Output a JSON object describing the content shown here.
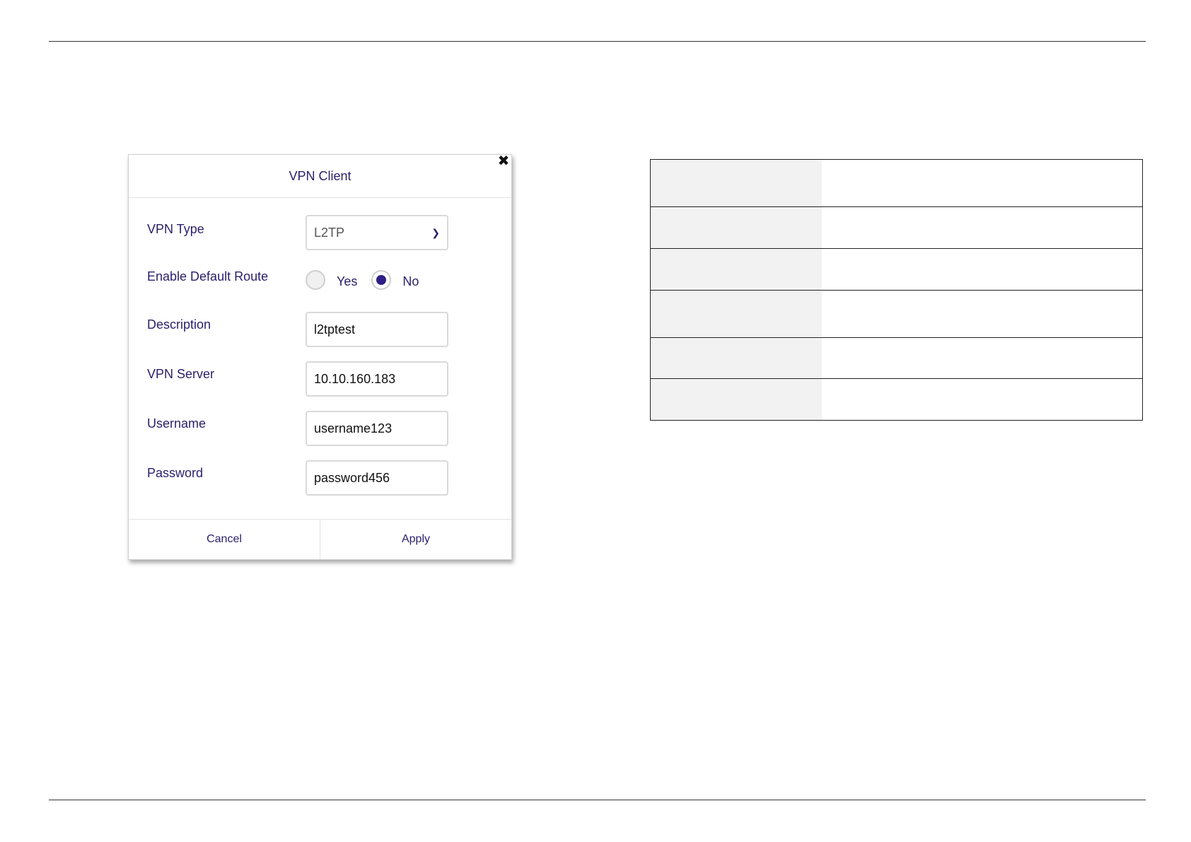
{
  "dialog": {
    "title": "VPN Client",
    "close_icon": "close-icon",
    "fields": {
      "vpn_type": {
        "label": "VPN Type",
        "value": "L2TP"
      },
      "default_route": {
        "label": "Enable Default Route",
        "options": [
          "Yes",
          "No"
        ],
        "selected": "No"
      },
      "description": {
        "label": "Description",
        "value": "l2tptest"
      },
      "vpn_server": {
        "label": "VPN Server",
        "value": "10.10.160.183"
      },
      "username": {
        "label": "Username",
        "value": "username123"
      },
      "password": {
        "label": "Password",
        "value": "password456"
      }
    },
    "buttons": {
      "cancel": "Cancel",
      "apply": "Apply"
    }
  },
  "table": {
    "rows": 6,
    "columns": 2
  },
  "colors": {
    "accent": "#2d1f86",
    "text": "#2a1f6b"
  }
}
